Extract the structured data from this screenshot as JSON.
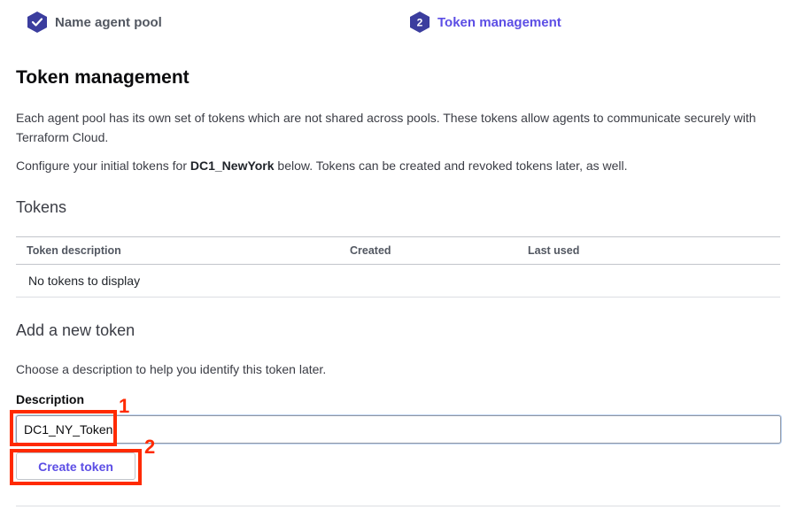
{
  "steps": [
    {
      "label": "Name agent pool",
      "state": "completed",
      "icon": "check-icon"
    },
    {
      "number": "2",
      "label": "Token management",
      "state": "active"
    }
  ],
  "colors": {
    "brand": "#5c4ee5",
    "step_done": "#3b3d9e",
    "annotation": "#ff2a00"
  },
  "page": {
    "title": "Token management",
    "description": "Each agent pool has its own set of tokens which are not shared across pools. These tokens allow agents to communicate securely with Terraform Cloud.",
    "configure_before": "Configure your initial tokens for ",
    "pool_name": "DC1_NewYork",
    "configure_after": " below. Tokens can be created and revoked tokens later, as well."
  },
  "tokens": {
    "heading": "Tokens",
    "columns": [
      "Token description",
      "Created",
      "Last used"
    ],
    "empty_text": "No tokens to display"
  },
  "add_token": {
    "heading": "Add a new token",
    "help": "Choose a description to help you identify this token later.",
    "field_label": "Description",
    "field_value": "DC1_NY_Token",
    "button_label": "Create token"
  },
  "annotations": [
    "1",
    "2"
  ]
}
